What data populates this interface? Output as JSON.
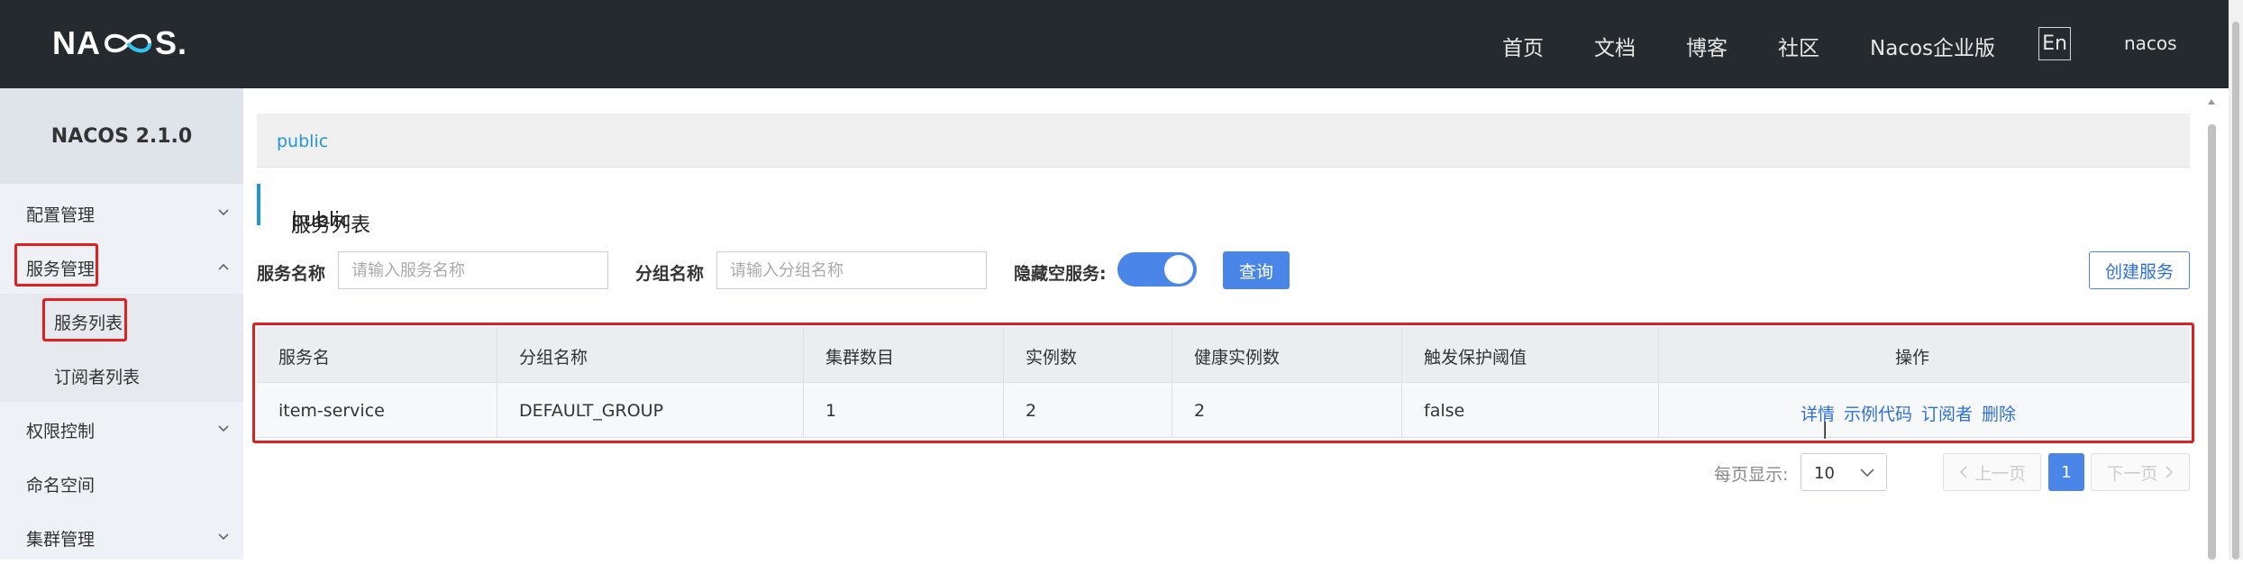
{
  "header": {
    "logo_text": "NACOS.",
    "nav": [
      "首页",
      "文档",
      "博客",
      "社区",
      "Nacos企业版"
    ],
    "lang_button": "En",
    "user": "nacos"
  },
  "sidebar": {
    "version": "NACOS 2.1.0",
    "items": [
      {
        "label": "配置管理",
        "expanded": false
      },
      {
        "label": "服务管理",
        "expanded": true
      },
      {
        "label": "权限控制",
        "expanded": false
      },
      {
        "label": "命名空间"
      },
      {
        "label": "集群管理",
        "expanded": false
      }
    ],
    "service_sub": [
      "服务列表",
      "订阅者列表"
    ]
  },
  "main": {
    "namespace_tab": "public",
    "title": "服务列表",
    "title_separator": "|",
    "title_namespace": "public",
    "filters": {
      "service_name_label": "服务名称",
      "service_name_placeholder": "请输入服务名称",
      "group_name_label": "分组名称",
      "group_name_placeholder": "请输入分组名称",
      "hide_empty_label": "隐藏空服务:",
      "hide_empty_on": true,
      "query_button": "查询",
      "create_button": "创建服务"
    },
    "table": {
      "columns": [
        "服务名",
        "分组名称",
        "集群数目",
        "实例数",
        "健康实例数",
        "触发保护阈值",
        "操作"
      ],
      "rows": [
        {
          "service": "item-service",
          "group": "DEFAULT_GROUP",
          "clusters": "1",
          "instances": "2",
          "healthy": "2",
          "threshold": "false"
        }
      ],
      "actions": [
        "详情",
        "示例代码",
        "订阅者",
        "删除"
      ],
      "action_separator": "|"
    },
    "pagination": {
      "per_page_label": "每页显示:",
      "per_page": "10",
      "prev": "上一页",
      "current": "1",
      "next": "下一页"
    }
  },
  "colors": {
    "topbar": "#252a2f",
    "accent": "#4a86e8",
    "link": "#2e6fd6",
    "highlight": "#e02020"
  }
}
